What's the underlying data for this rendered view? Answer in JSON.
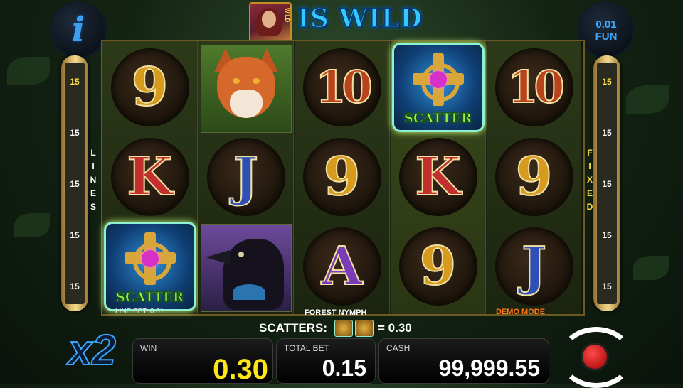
{
  "header": {
    "wild_symbol_label": "WILD",
    "wild_text": "IS WILD",
    "info_glyph": "i",
    "denomination": "0.01",
    "currency": "FUN"
  },
  "side": {
    "left_lines": [
      "15",
      "15",
      "15",
      "15",
      "15"
    ],
    "right_lines": [
      "15",
      "15",
      "15",
      "15",
      "15"
    ],
    "left_label": "LINES",
    "right_label": "FIXED"
  },
  "reels": {
    "reel1": [
      "9",
      "K",
      "SCATTER"
    ],
    "reel2": [
      "fox",
      "J",
      "raven"
    ],
    "reel3": [
      "10",
      "9",
      "A"
    ],
    "reel4": [
      "SCATTER",
      "K",
      "9"
    ],
    "reel5": [
      "10",
      "9",
      "J"
    ],
    "scatter_word": "SCATTER"
  },
  "info_bar": {
    "line_bet": "LINE BET: 0.01",
    "game_name": "FOREST NYMPH",
    "demo_mode": "DEMO MODE",
    "scatters_label": "SCATTERS:",
    "scatters_value": "= 0.30"
  },
  "bottom": {
    "multiplier": "x2",
    "win_label": "WIN",
    "win_value": "0.30",
    "bet_label": "TOTAL BET",
    "bet_value": "0.15",
    "cash_label": "CASH",
    "cash_value": "99,999.55"
  },
  "colors": {
    "accent_blue": "#3ea8ff",
    "win_yellow": "#ffe41a",
    "demo_orange": "#ff7a10",
    "scatter_green": "#9cf04a"
  }
}
